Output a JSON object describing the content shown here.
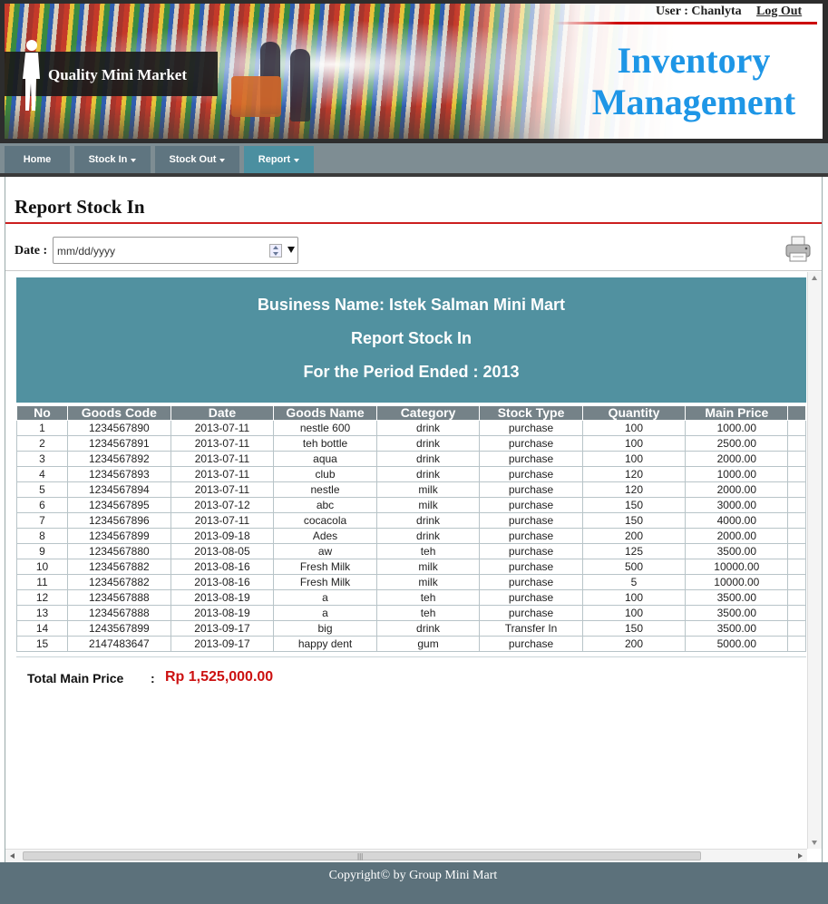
{
  "header": {
    "brand": "Quality Mini Market",
    "user_label": "User : Chanlyta",
    "logout_label": "Log Out",
    "title_line1": "Inventory",
    "title_line2": "Management"
  },
  "nav": {
    "items": [
      {
        "label": "Home",
        "dropdown": false
      },
      {
        "label": "Stock In",
        "dropdown": true
      },
      {
        "label": "Stock Out",
        "dropdown": true
      },
      {
        "label": "Report",
        "dropdown": true,
        "active": true
      }
    ]
  },
  "page": {
    "title": "Report Stock In",
    "date_label": "Date :",
    "date_placeholder": "mm/dd/yyyy"
  },
  "report": {
    "business_name": "Business Name: Istek Salman Mini Mart",
    "title": "Report Stock In",
    "period": "For the Period Ended : 2013",
    "columns": [
      "No",
      "Goods Code",
      "Date",
      "Goods Name",
      "Category",
      "Stock Type",
      "Quantity",
      "Main Price"
    ],
    "rows": [
      [
        "1",
        "1234567890",
        "2013-07-11",
        "nestle 600",
        "drink",
        "purchase",
        "100",
        "1000.00"
      ],
      [
        "2",
        "1234567891",
        "2013-07-11",
        "teh bottle",
        "drink",
        "purchase",
        "100",
        "2500.00"
      ],
      [
        "3",
        "1234567892",
        "2013-07-11",
        "aqua",
        "drink",
        "purchase",
        "100",
        "2000.00"
      ],
      [
        "4",
        "1234567893",
        "2013-07-11",
        "club",
        "drink",
        "purchase",
        "120",
        "1000.00"
      ],
      [
        "5",
        "1234567894",
        "2013-07-11",
        "nestle",
        "milk",
        "purchase",
        "120",
        "2000.00"
      ],
      [
        "6",
        "1234567895",
        "2013-07-12",
        "abc",
        "milk",
        "purchase",
        "150",
        "3000.00"
      ],
      [
        "7",
        "1234567896",
        "2013-07-11",
        "cocacola",
        "drink",
        "purchase",
        "150",
        "4000.00"
      ],
      [
        "8",
        "1234567899",
        "2013-09-18",
        "Ades",
        "drink",
        "purchase",
        "200",
        "2000.00"
      ],
      [
        "9",
        "1234567880",
        "2013-08-05",
        "aw",
        "teh",
        "purchase",
        "125",
        "3500.00"
      ],
      [
        "10",
        "1234567882",
        "2013-08-16",
        "Fresh Milk",
        "milk",
        "purchase",
        "500",
        "10000.00"
      ],
      [
        "11",
        "1234567882",
        "2013-08-16",
        "Fresh Milk",
        "milk",
        "purchase",
        "5",
        "10000.00"
      ],
      [
        "12",
        "1234567888",
        "2013-08-19",
        "a",
        "teh",
        "purchase",
        "100",
        "3500.00"
      ],
      [
        "13",
        "1234567888",
        "2013-08-19",
        "a",
        "teh",
        "purchase",
        "100",
        "3500.00"
      ],
      [
        "14",
        "1243567899",
        "2013-09-17",
        "big",
        "drink",
        "Transfer In",
        "150",
        "3500.00"
      ],
      [
        "15",
        "2147483647",
        "2013-09-17",
        "happy dent",
        "gum",
        "purchase",
        "200",
        "5000.00"
      ]
    ],
    "total_label": "Total Main Price",
    "total_colon": ":",
    "total_value": "Rp 1,525,000.00"
  },
  "footer": {
    "text": "Copyright© by Group Mini Mart"
  },
  "colors": {
    "accent_blue": "#1e96e6",
    "report_header": "#5191a0",
    "table_header": "#758288",
    "rule_red": "#cc1f1f",
    "total_red": "#cc1111",
    "nav_bar": "#7e8d93",
    "footer": "#5c717b"
  },
  "icons": [
    "printer-icon",
    "calendar-spin-icon",
    "dropdown-caret-icon"
  ]
}
